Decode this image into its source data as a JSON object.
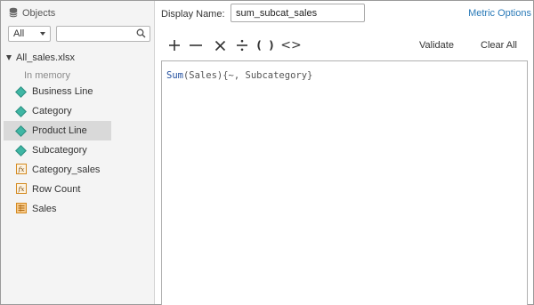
{
  "sidebar": {
    "header_label": "Objects",
    "filter_value": "All",
    "search_value": "",
    "dataset_name": "All_sales.xlsx",
    "dataset_sub": "In memory",
    "items": [
      {
        "label": "Business Line",
        "icon": "attribute-diamond-icon"
      },
      {
        "label": "Category",
        "icon": "attribute-diamond-icon"
      },
      {
        "label": "Product Line",
        "icon": "attribute-diamond-icon"
      },
      {
        "label": "Subcategory",
        "icon": "attribute-diamond-icon"
      },
      {
        "label": "Category_sales",
        "icon": "fx-metric-icon"
      },
      {
        "label": "Row Count",
        "icon": "fx-metric-icon"
      },
      {
        "label": "Sales",
        "icon": "metric-icon"
      }
    ],
    "selected_item": "Product Line"
  },
  "main": {
    "display_name_label": "Display Name:",
    "display_name_value": "sum_subcat_sales",
    "metric_options_label": "Metric Options",
    "validate_label": "Validate",
    "clear_all_label": "Clear All",
    "toolbar": {
      "parens_label": "( )",
      "angles_label": "<>"
    },
    "formula_fn": "Sum",
    "formula_rest": "(Sales){~, Subcategory}"
  },
  "colors": {
    "attribute": "#3fb6a4",
    "metric": "#e08a1e",
    "link": "#2a7ab8"
  }
}
